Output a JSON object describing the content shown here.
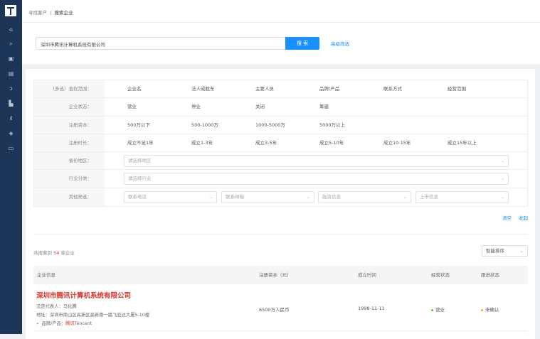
{
  "sidebar": {
    "items": [
      "home-icon",
      "search-icon",
      "contact-icon",
      "list-icon",
      "key-icon",
      "chart-area-icon",
      "chart-bar-icon",
      "tag-icon",
      "card-icon"
    ]
  },
  "breadcrumb": {
    "parent": "寻找客户",
    "sep": "/",
    "current": "搜索企业"
  },
  "search": {
    "value": "深圳市腾讯计算机系统有限公司",
    "button": "搜 索",
    "advanced": "高级筛选"
  },
  "filters": {
    "scope": {
      "label": "（多选）查找范围：",
      "options": [
        "企业名",
        "法人或股东",
        "主要人员",
        "品牌/产品",
        "联系方式",
        "经营范围"
      ]
    },
    "status": {
      "label": "企业状态：",
      "options": [
        "营业",
        "停业",
        "关闭",
        "筹建"
      ]
    },
    "capital": {
      "label": "注册资本：",
      "options": [
        "500万以下",
        "500-1000万",
        "1000-5000万",
        "5000万以上"
      ]
    },
    "age": {
      "label": "注册时长：",
      "options": [
        "成立不足1年",
        "成立1-3年",
        "成立3-5年",
        "成立5-10年",
        "成立10-15年",
        "成立15年以上"
      ]
    },
    "region": {
      "label": "省份地区：",
      "placeholder": "请选择地区"
    },
    "industry": {
      "label": "行业分类：",
      "placeholder": "请选择行业"
    },
    "other": {
      "label": "其他筛选：",
      "selects": [
        "联系电话",
        "联系邮箱",
        "融资信息",
        "上市信息"
      ]
    }
  },
  "actions": {
    "clear": "清空",
    "collapse": "收起"
  },
  "results": {
    "prefix": "共搜索到",
    "count": "54",
    "suffix": "家企业",
    "sort": "智能排序",
    "columns": [
      "企业信息",
      "注册资本（元）",
      "成立时间",
      "经营状态",
      "跟进状态"
    ],
    "rows": [
      {
        "name": "深圳市腾讯计算机系统有限公司",
        "legal": "法定代表人：马化腾",
        "address": "地址：深圳市南山区高新区高新南一路飞亚达大厦5-10楼",
        "brand_label": "品牌/产品：",
        "brand_hl": "腾讯",
        "brand_rest": "Tencent",
        "capital": "6500万人民币",
        "founded": "1998-11-11",
        "status": "营业",
        "follow": "未确认"
      }
    ]
  },
  "colors": {
    "accent": "#1890ff",
    "sidebar": "#1d3557",
    "highlight": "#e0342b",
    "status_ok": "#52c41a",
    "status_pending": "#faad14"
  }
}
